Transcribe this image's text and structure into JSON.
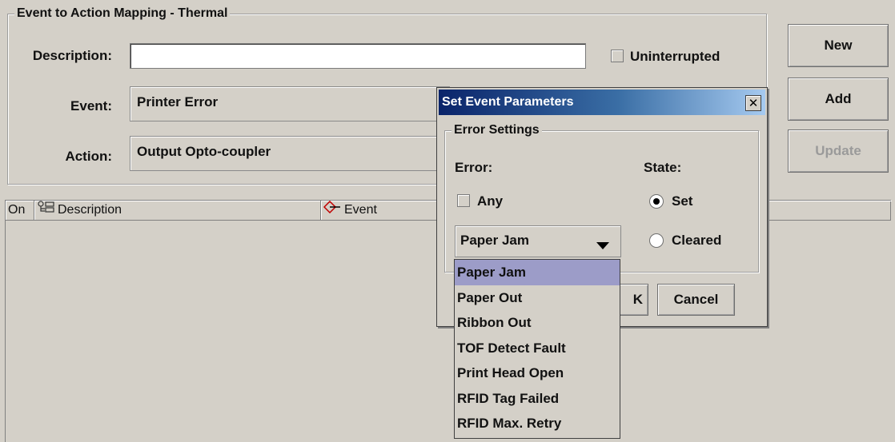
{
  "mapping_group": {
    "title": "Event to Action Mapping - Thermal",
    "description_label": "Description:",
    "description_value": "",
    "uninterrupted_label": "Uninterrupted",
    "uninterrupted_checked": false,
    "event_label": "Event:",
    "event_value": "Printer Error",
    "action_label": "Action:",
    "action_value": "Output Opto-coupler"
  },
  "buttons": {
    "new": "New",
    "add": "Add",
    "update": "Update"
  },
  "table": {
    "columns": [
      "On",
      "Description",
      "Event"
    ],
    "rows": []
  },
  "dialog": {
    "title": "Set Event Parameters",
    "close": "✕",
    "group_title": "Error Settings",
    "error_label": "Error:",
    "state_label": "State:",
    "any_label": "Any",
    "any_checked": false,
    "state_options": [
      "Set",
      "Cleared"
    ],
    "state_selected": "Set",
    "error_selected": "Paper Jam",
    "ok_partial": "K",
    "cancel": "Cancel",
    "error_options": [
      "Paper Jam",
      "Paper Out",
      "Ribbon Out",
      "TOF Detect Fault",
      "Print Head Open",
      "RFID Tag Failed",
      "RFID Max. Retry"
    ]
  },
  "icons": {
    "description_col": "tree-node-icon",
    "event_col": "diamond-arrow-icon",
    "dropdown": "triangle-down-icon",
    "close": "close-icon"
  }
}
